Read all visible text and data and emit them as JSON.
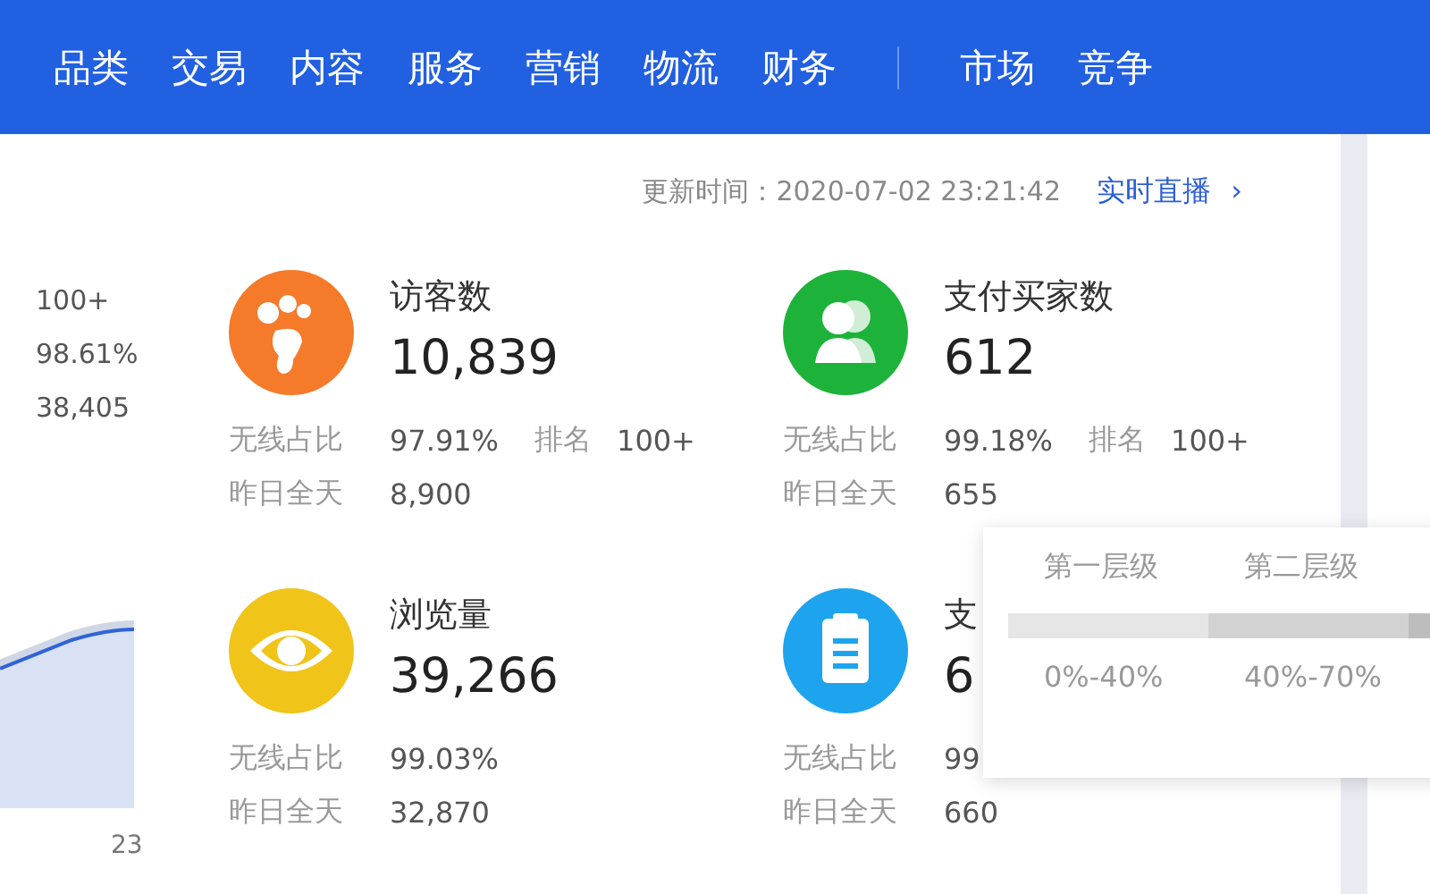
{
  "nav": {
    "groups": [
      [
        "品类",
        "交易",
        "内容",
        "服务",
        "营销",
        "物流",
        "财务"
      ],
      [
        "市场",
        "竞争"
      ]
    ]
  },
  "update": {
    "label": "更新时间：",
    "time": "2020-07-02 23:21:42",
    "link": "实时直播",
    "chevron": "›"
  },
  "left_column": {
    "values": [
      "100+",
      "98.61%",
      "38,405"
    ],
    "chart_tick": "23"
  },
  "metrics": [
    {
      "kind": "footprint",
      "color": "#f57a2a",
      "title": "访客数",
      "value": "10,839",
      "stats": [
        {
          "label": "无线占比",
          "value": "97.91%",
          "rank_label": "排名",
          "rank": "100+"
        },
        {
          "label": "昨日全天",
          "value": "8,900"
        }
      ]
    },
    {
      "kind": "people",
      "color": "#1db33a",
      "title": "支付买家数",
      "value": "612",
      "stats": [
        {
          "label": "无线占比",
          "value": "99.18%",
          "rank_label": "排名",
          "rank": "100+"
        },
        {
          "label": "昨日全天",
          "value": "655"
        }
      ]
    },
    {
      "kind": "eye",
      "color": "#f0c419",
      "title": "浏览量",
      "value": "39,266",
      "stats": [
        {
          "label": "无线占比",
          "value": "99.03%"
        },
        {
          "label": "昨日全天",
          "value": "32,870"
        }
      ]
    },
    {
      "kind": "clipboard",
      "color": "#1ea4ee",
      "title": "支",
      "value": "6",
      "stats": [
        {
          "label": "无线占比",
          "value": "99"
        },
        {
          "label": "昨日全天",
          "value": "660"
        }
      ]
    }
  ],
  "tooltip": {
    "tiers": [
      {
        "label": "第一层级",
        "range": "0%-40%",
        "color": "#e6e6e6"
      },
      {
        "label": "第二层级",
        "range": "40%-70%",
        "color": "#d2d2d2"
      },
      {
        "color": "#bdbdbd"
      }
    ]
  }
}
